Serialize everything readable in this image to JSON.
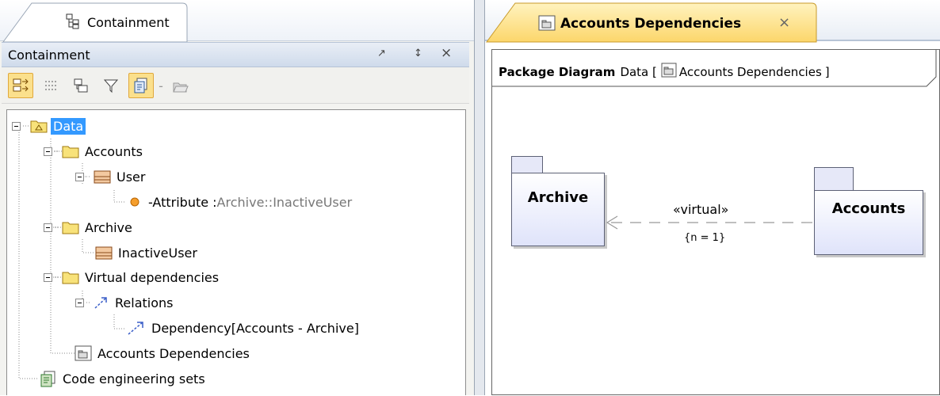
{
  "left_panel": {
    "tab_label": "Containment",
    "header_title": "Containment",
    "header_buttons": [
      "↗",
      "↕",
      "×"
    ],
    "tree": [
      {
        "label": "Data",
        "selected": true
      },
      {
        "label": "Accounts"
      },
      {
        "label": "User"
      },
      {
        "label": "-Attribute : ",
        "suffix": "Archive::InactiveUser"
      },
      {
        "label": "Archive"
      },
      {
        "label": "InactiveUser"
      },
      {
        "label": "Virtual dependencies"
      },
      {
        "label": "Relations"
      },
      {
        "label": "Dependency[Accounts - Archive]"
      },
      {
        "label": "Accounts Dependencies"
      },
      {
        "label": "Code engineering sets"
      }
    ]
  },
  "right_panel": {
    "tab_label": "Accounts Dependencies",
    "tab_close": "×",
    "frame": {
      "kind": "Package Diagram",
      "prefix": "Data [",
      "name": "Accounts Dependencies",
      "suffix": "]"
    },
    "packages": {
      "left": "Archive",
      "right": "Accounts"
    },
    "dependency": {
      "stereotype": "«virtual»",
      "constraint": "{n = 1}"
    }
  },
  "colors": {
    "selection": "#3399ff",
    "package_fill": "#dfe3fa",
    "folder_yellow": "#f8e27a"
  }
}
